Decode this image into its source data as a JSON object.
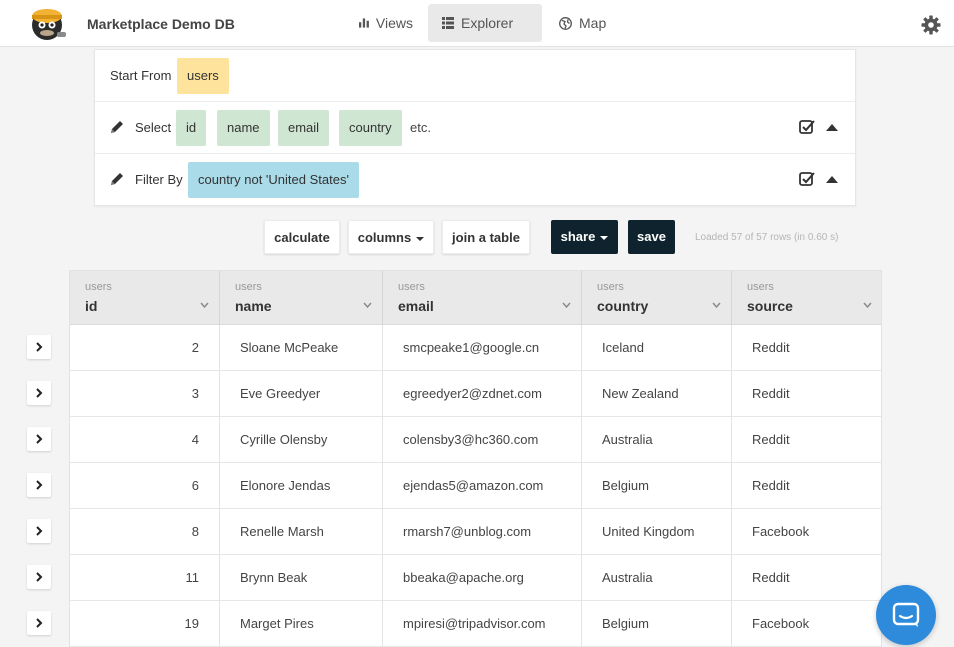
{
  "app": {
    "title": "Marketplace Demo DB"
  },
  "nav": [
    {
      "label": "Views",
      "icon": "bar-chart-icon",
      "active": false
    },
    {
      "label": "Explorer",
      "icon": "list-icon",
      "active": true
    },
    {
      "label": "Map",
      "icon": "globe-icon",
      "active": false
    }
  ],
  "query": {
    "start_label": "Start From",
    "table": "users",
    "select_label": "Select",
    "columns": [
      "id",
      "name",
      "email",
      "country"
    ],
    "more": "etc.",
    "filter_label": "Filter By",
    "filter": "country not 'United States'"
  },
  "toolbar": {
    "calculate": "calculate",
    "columns": "columns",
    "join": "join a table",
    "share": "share",
    "save": "save",
    "status": "Loaded 57 of 57 rows (in 0.60 s)"
  },
  "table": {
    "headers": [
      {
        "table": "users",
        "column": "id"
      },
      {
        "table": "users",
        "column": "name"
      },
      {
        "table": "users",
        "column": "email"
      },
      {
        "table": "users",
        "column": "country"
      },
      {
        "table": "users",
        "column": "source"
      }
    ],
    "rows": [
      [
        "2",
        "Sloane McPeake",
        "smcpeake1@google.cn",
        "Iceland",
        "Reddit"
      ],
      [
        "3",
        "Eve Greedyer",
        "egreedyer2@zdnet.com",
        "New Zealand",
        "Reddit"
      ],
      [
        "4",
        "Cyrille Olensby",
        "colensby3@hc360.com",
        "Australia",
        "Reddit"
      ],
      [
        "6",
        "Elonore Jendas",
        "ejendas5@amazon.com",
        "Belgium",
        "Reddit"
      ],
      [
        "8",
        "Renelle Marsh",
        "rmarsh7@unblog.com",
        "United Kingdom",
        "Facebook"
      ],
      [
        "11",
        "Brynn Beak",
        "bbeaka@apache.org",
        "Australia",
        "Reddit"
      ],
      [
        "19",
        "Marget Pires",
        "mpiresi@tripadvisor.com",
        "Belgium",
        "Facebook"
      ]
    ]
  },
  "colors": {
    "table_chip": "#fde39b",
    "column_chip": "#cfe6d3",
    "filter_chip": "#a9dbe8",
    "dark_button": "#0f232f",
    "chat": "#2e8bdc"
  }
}
